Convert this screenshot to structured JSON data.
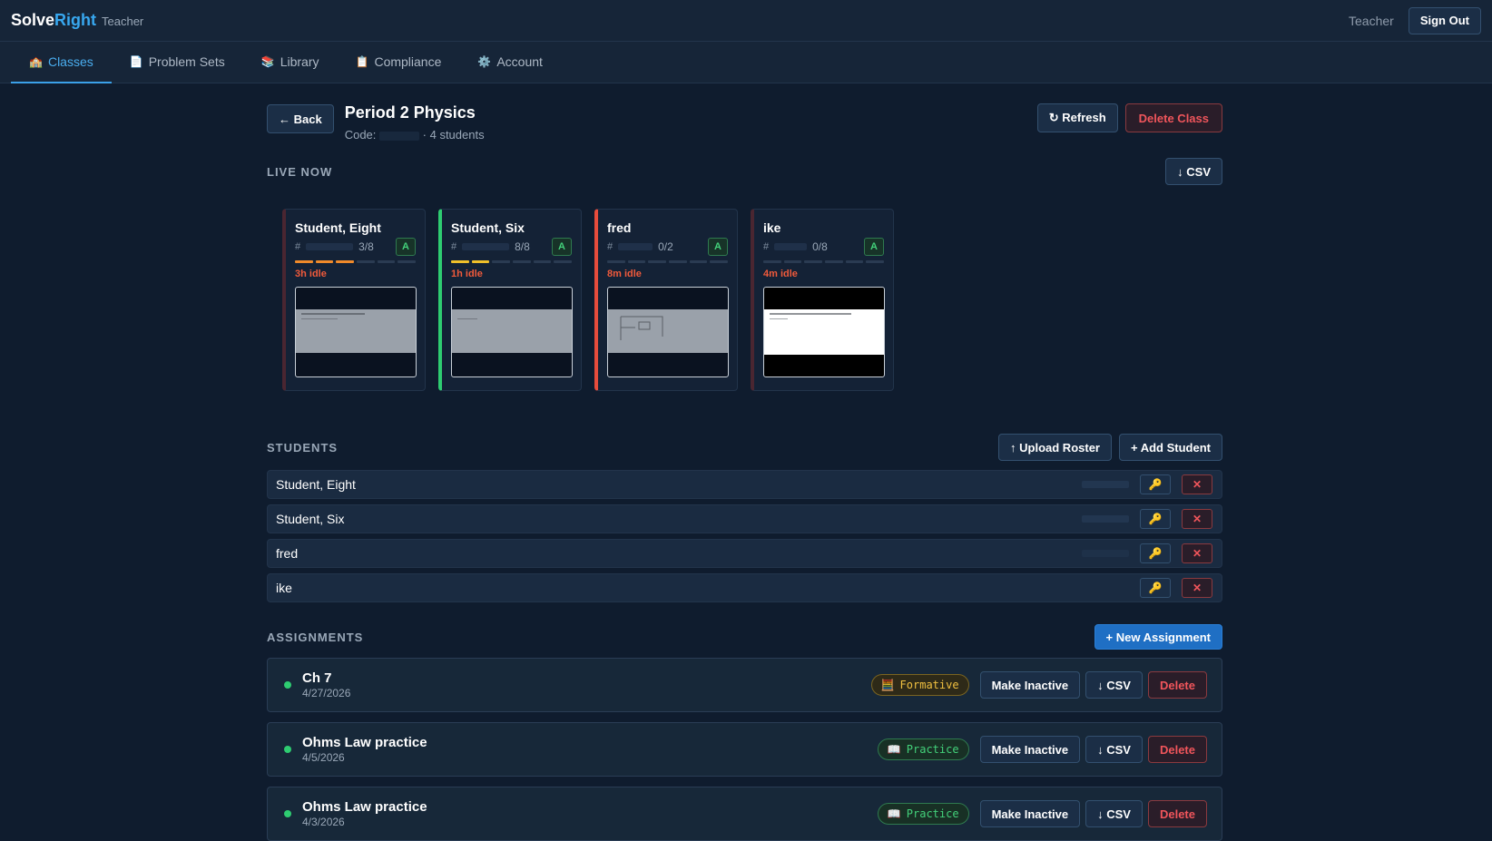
{
  "header": {
    "brand_main": "Solve",
    "brand_accent": "Right",
    "brand_role": "Teacher",
    "user_label": "Teacher",
    "sign_out": "Sign Out"
  },
  "nav": {
    "tabs": [
      {
        "label": "Classes",
        "icon": "school-icon",
        "active": true
      },
      {
        "label": "Problem Sets",
        "icon": "document-icon",
        "active": false
      },
      {
        "label": "Library",
        "icon": "books-icon",
        "active": false
      },
      {
        "label": "Compliance",
        "icon": "clipboard-icon",
        "active": false
      },
      {
        "label": "Account",
        "icon": "gear-icon",
        "active": false
      }
    ]
  },
  "class": {
    "back_label": "← Back",
    "title": "Period 2 Physics",
    "code_label": "Code:",
    "student_count": "· 4 students",
    "refresh_label": "↻ Refresh",
    "delete_label": "Delete Class"
  },
  "live": {
    "section_title": "LIVE NOW",
    "csv_label": "↓ CSV",
    "cards": [
      {
        "name": "Student, Eight",
        "id_prefix": "#",
        "progress": "3/8",
        "badge": "A",
        "idle": "3h idle",
        "status": "dim",
        "bar_color": "orange",
        "filled": 3,
        "total": 6
      },
      {
        "name": "Student, Six",
        "id_prefix": "#",
        "progress": "8/8",
        "badge": "A",
        "idle": "1h idle",
        "status": "green",
        "bar_color": "yellow",
        "filled": 2,
        "total": 6
      },
      {
        "name": "fred",
        "id_prefix": "#",
        "progress": "0/2",
        "badge": "A",
        "idle": "8m idle",
        "status": "red",
        "bar_color": "none",
        "filled": 0,
        "total": 6
      },
      {
        "name": "ike",
        "id_prefix": "#",
        "progress": "0/8",
        "badge": "A",
        "idle": "4m idle",
        "status": "dim",
        "bar_color": "none",
        "filled": 0,
        "total": 6
      }
    ]
  },
  "students": {
    "section_title": "STUDENTS",
    "upload_label": "↑ Upload Roster",
    "add_label": "+ Add Student",
    "rows": [
      {
        "name": "Student, Eight"
      },
      {
        "name": "Student, Six"
      },
      {
        "name": "fred"
      },
      {
        "name": "ike"
      }
    ]
  },
  "assignments": {
    "section_title": "ASSIGNMENTS",
    "new_label": "+ New Assignment",
    "items": [
      {
        "title": "Ch 7",
        "date": "4/27/2026",
        "tag": "Formative",
        "tag_icon": "calculator-icon",
        "tag_type": "formative",
        "inactive_label": "Make Inactive",
        "csv_label": "↓ CSV",
        "delete_label": "Delete"
      },
      {
        "title": "Ohms Law practice",
        "date": "4/5/2026",
        "tag": "Practice",
        "tag_icon": "book-icon",
        "tag_type": "practice",
        "inactive_label": "Make Inactive",
        "csv_label": "↓ CSV",
        "delete_label": "Delete"
      },
      {
        "title": "Ohms Law practice",
        "date": "4/3/2026",
        "tag": "Practice",
        "tag_icon": "book-icon",
        "tag_type": "practice",
        "inactive_label": "Make Inactive",
        "csv_label": "↓ CSV",
        "delete_label": "Delete"
      }
    ]
  },
  "colors": {
    "background": "#0f1c2e",
    "accent": "#38a8f0",
    "danger": "#f0555b",
    "success": "#2ecc71",
    "warning": "#f0c040"
  }
}
